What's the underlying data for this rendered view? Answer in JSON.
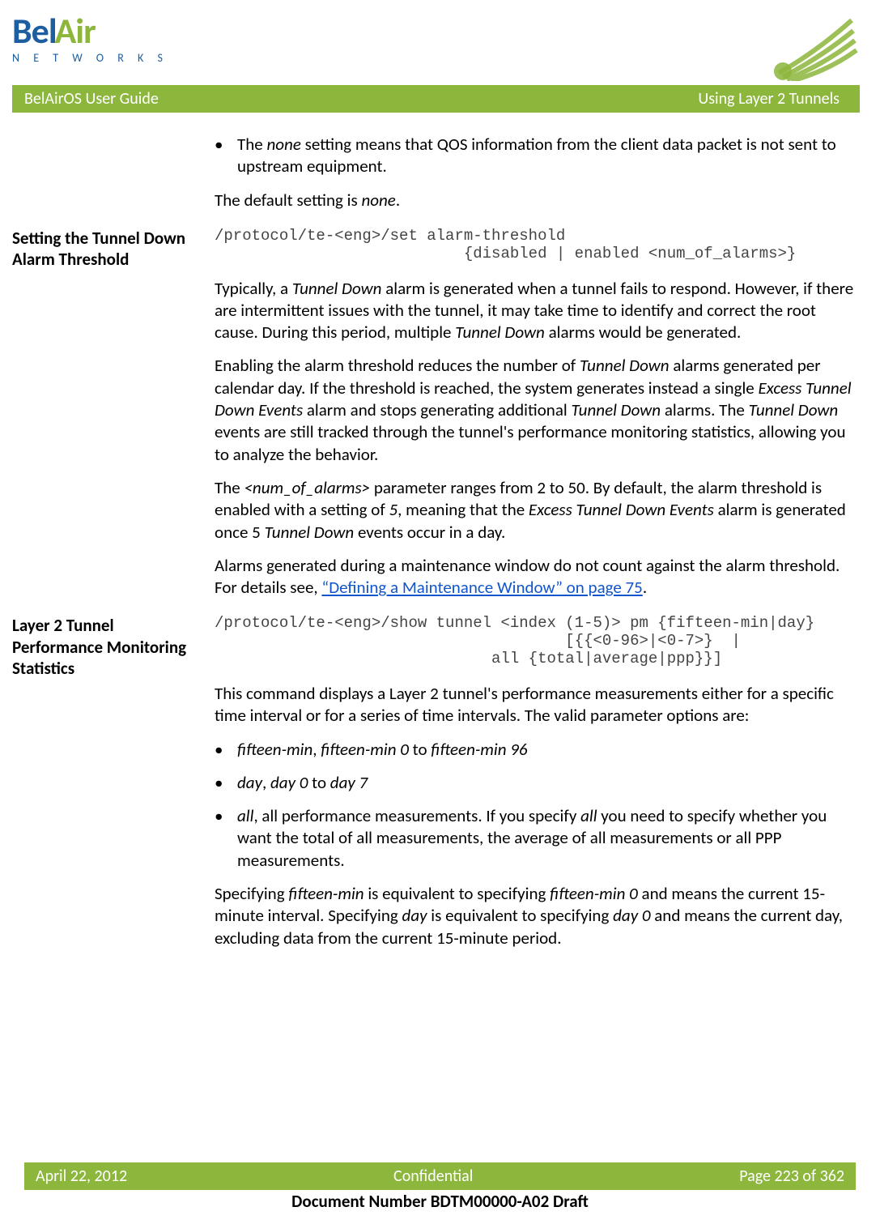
{
  "header": {
    "logo_bel": "Bel",
    "logo_air": "Air",
    "logo_sub": "N E T W O R K S"
  },
  "title_bar": {
    "left": "BelAirOS User Guide",
    "right": "Using Layer 2 Tunnels"
  },
  "intro": {
    "bullet1_a": "The ",
    "bullet1_b": "none",
    "bullet1_c": " setting means that QOS information from the client data packet is not sent to upstream equipment.",
    "default_a": "The default setting is ",
    "default_b": "none",
    "default_c": "."
  },
  "section1": {
    "label": "Setting the Tunnel Down Alarm Threshold",
    "cmd": "/protocol/te-<eng>/set alarm-threshold\n                           {disabled | enabled <num_of_alarms>}",
    "p1_a": "Typically, a ",
    "p1_b": "Tunnel Down",
    "p1_c": " alarm is generated when a tunnel fails to respond. However, if there are intermittent issues with the tunnel, it may take time to identify and correct the root cause. During this period, multiple ",
    "p1_d": "Tunnel Down",
    "p1_e": " alarms would be generated.",
    "p2_a": "Enabling the alarm threshold reduces the number of ",
    "p2_b": "Tunnel Down",
    "p2_c": " alarms generated per calendar day. If the threshold is reached, the system generates instead a single ",
    "p2_d": "Excess Tunnel Down Events",
    "p2_e": " alarm and stops generating additional ",
    "p2_f": "Tunnel Down",
    "p2_g": " alarms. The ",
    "p2_h": "Tunnel Down",
    "p2_i": " events are still tracked through the tunnel's performance monitoring statistics, allowing you to analyze the behavior.",
    "p3_a": "The ",
    "p3_b": "<num_of_alarms>",
    "p3_c": " parameter ranges from 2 to 50. By default, the alarm threshold is enabled with a setting of ",
    "p3_d": "5",
    "p3_e": ", meaning that the ",
    "p3_f": "Excess Tunnel Down Events",
    "p3_g": " alarm is generated once 5 ",
    "p3_h": "Tunnel Down",
    "p3_i": " events occur in a day.",
    "p4_a": "Alarms generated during a maintenance window do not count against the alarm threshold. For details see, ",
    "p4_link": "“Defining a Maintenance Window” on page 75",
    "p4_b": "."
  },
  "section2": {
    "label": "Layer 2 Tunnel Performance Monitoring Statistics",
    "cmd": "/protocol/te-<eng>/show tunnel <index (1-5)> pm {fifteen-min|day}\n                                      [{{<0-96>|<0-7>}  |\n                              all {total|average|ppp}}]",
    "p1": "This command displays a Layer 2 tunnel's performance measurements either for a specific time interval or for a series of time intervals. The valid parameter options are:",
    "b1_a": "fifteen-min",
    "b1_b": ", ",
    "b1_c": "fifteen-min 0",
    "b1_d": " to ",
    "b1_e": "fifteen-min 96",
    "b2_a": "day",
    "b2_b": ", ",
    "b2_c": "day 0",
    "b2_d": " to ",
    "b2_e": "day 7",
    "b3_a": "all",
    "b3_b": ", all performance measurements. If you specify ",
    "b3_c": "all",
    "b3_d": " you need to specify whether you want the total of all measurements, the average of all measurements or all PPP measurements.",
    "p2_a": "Specifying ",
    "p2_b": "fifteen-min",
    "p2_c": " is equivalent to specifying ",
    "p2_d": "fifteen-min 0",
    "p2_e": " and means the current 15-minute interval. Specifying ",
    "p2_f": "day",
    "p2_g": " is equivalent to specifying ",
    "p2_h": "day 0",
    "p2_i": " and means the current day, excluding data from the current 15-minute period."
  },
  "footer": {
    "left": "April 22, 2012",
    "center": "Confidential",
    "right": "Page 223 of 362",
    "docnum": "Document Number BDTM00000-A02 Draft"
  }
}
